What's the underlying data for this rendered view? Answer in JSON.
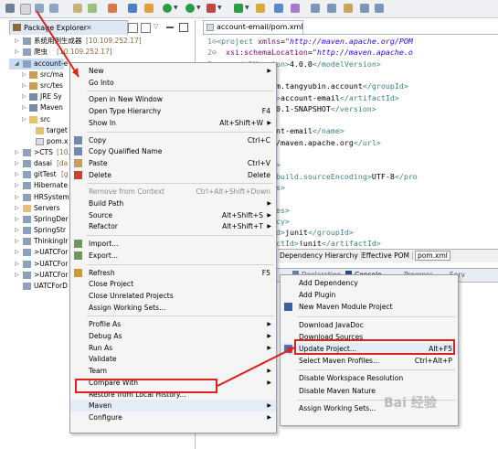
{
  "colors": {
    "accent_red": "#e0201a",
    "menu_bg": "#f5f5f5",
    "selection": "#c9dcf4"
  },
  "package_explorer": {
    "tab_label": "Package Explorer",
    "tree": [
      {
        "label": "系统用例生成器",
        "suffix": "[10.109.252.17]",
        "icon": "project-icon"
      },
      {
        "label": "爬虫",
        "suffix": "[10.109.252.17]",
        "icon": "project-icon"
      },
      {
        "label": "account-e",
        "suffix": "",
        "icon": "maven-project-icon"
      },
      {
        "label": "src/ma",
        "suffix": "",
        "icon": "source-folder-icon"
      },
      {
        "label": "src/tes",
        "suffix": "",
        "icon": "source-folder-icon"
      },
      {
        "label": "JRE Sy",
        "suffix": "",
        "icon": "library-icon"
      },
      {
        "label": "Maven",
        "suffix": "",
        "icon": "library-icon"
      },
      {
        "label": "src",
        "suffix": "",
        "icon": "folder-icon"
      },
      {
        "label": "target",
        "suffix": "",
        "icon": "folder-icon"
      },
      {
        "label": "pom.x",
        "suffix": "",
        "icon": "xml-file-icon"
      },
      {
        "label": ">CTS",
        "suffix": "[10.",
        "icon": "project-icon"
      },
      {
        "label": "dasai",
        "suffix": "[da",
        "icon": "project-icon"
      },
      {
        "label": "gitTest",
        "suffix": "[g",
        "icon": "project-icon"
      },
      {
        "label": "Hibernate",
        "suffix": "",
        "icon": "project-icon"
      },
      {
        "label": "HRSystem",
        "suffix": "",
        "icon": "project-icon"
      },
      {
        "label": "Servers",
        "suffix": "",
        "icon": "folder-icon"
      },
      {
        "label": "SpringDer",
        "suffix": "",
        "icon": "project-icon"
      },
      {
        "label": "SpringStr",
        "suffix": "",
        "icon": "project-icon"
      },
      {
        "label": "ThinkingIr",
        "suffix": "",
        "icon": "project-icon"
      },
      {
        "label": ">UATCFor",
        "suffix": "",
        "icon": "project-icon"
      },
      {
        "label": ">UATCFor",
        "suffix": "",
        "icon": "project-icon"
      },
      {
        "label": ">UATCFor",
        "suffix": "",
        "icon": "project-icon"
      },
      {
        "label": "UATCForD",
        "suffix": "",
        "icon": "project-icon"
      }
    ]
  },
  "editor": {
    "tab_label": "account-email/pom.xml",
    "lines": [
      {
        "n": "1",
        "html": "<span class='tg'>&lt;project</span> <span class='at'>xmlns</span>=<span class='av'>\"http://maven.apache.org/POM</span>"
      },
      {
        "n": "2",
        "html": "  <span class='at'>xsi:schemaLocation</span>=<span class='av'>\"http://maven.apache.o</span>"
      },
      {
        "n": "3",
        "html": "  <span class='tg'>&lt;modelVersion&gt;</span>4.0.0<span class='tg'>&lt;/modelVersion&gt;</span>"
      },
      {
        "n": "",
        "html": ""
      },
      {
        "n": "",
        "html": "  <span class='tg'>&lt;groupId&gt;</span>com.tangyubin.account<span class='tg'>&lt;/groupId&gt;</span>"
      },
      {
        "n": "",
        "html": "  <span class='tg'>&lt;artifactId&gt;</span>account-email<span class='tg'>&lt;/artifactId&gt;</span>"
      },
      {
        "n": "",
        "html": "  <span class='tg'>&lt;version&gt;</span>0.0.1-SNAPSHOT<span class='tg'>&lt;/version&gt;</span>"
      },
      {
        "n": "",
        "html": ""
      },
      {
        "n": "",
        "html": "  <span class='tg'>&lt;name&gt;</span>account-email<span class='tg'>&lt;/name&gt;</span>"
      },
      {
        "n": "",
        "html": "  <span class='tg'>&lt;url&gt;</span>http://maven.apache.org<span class='tg'>&lt;/url&gt;</span>"
      },
      {
        "n": "",
        "html": ""
      },
      {
        "n": "",
        "html": "  <span class='tg'>&lt;properties&gt;</span>"
      },
      {
        "n": "",
        "html": "    <span class='tg'>&lt;project.build.sourceEncoding&gt;</span>UTF-8<span class='tg'>&lt;/pro</span>"
      },
      {
        "n": "",
        "html": "  <span class='tg'>&lt;/properties&gt;</span>"
      },
      {
        "n": "",
        "html": ""
      },
      {
        "n": "",
        "html": "  <span class='tg'>&lt;dependencies&gt;</span>"
      },
      {
        "n": "",
        "html": "    <span class='tg'>&lt;dependency&gt;</span>"
      },
      {
        "n": "",
        "html": "      <span class='tg'>&lt;groupId&gt;</span>junit<span class='tg'>&lt;/groupId&gt;</span>"
      },
      {
        "n": "",
        "html": "      <span class='tg'>&lt;artifactId&gt;</span>junit<span class='tg'>&lt;/artifactId&gt;</span>"
      }
    ],
    "bottom_tabs": [
      "Dependency Hierarchy",
      "Effective POM",
      "pom.xml"
    ]
  },
  "console_tabs": [
    "Declaration",
    "Console",
    "Progress",
    "Serv"
  ],
  "context_menu": {
    "items": [
      {
        "label": "New",
        "key": "",
        "arrow": true
      },
      {
        "label": "Go Into",
        "key": ""
      },
      {
        "sep": true
      },
      {
        "label": "Open in New Window",
        "key": ""
      },
      {
        "label": "Open Type Hierarchy",
        "key": "F4"
      },
      {
        "label": "Show In",
        "key": "Alt+Shift+W",
        "arrow": true
      },
      {
        "sep": true
      },
      {
        "label": "Copy",
        "key": "Ctrl+C",
        "icon": "copy-icon"
      },
      {
        "label": "Copy Qualified Name",
        "key": "",
        "icon": "copy-icon"
      },
      {
        "label": "Paste",
        "key": "Ctrl+V",
        "icon": "paste-icon"
      },
      {
        "label": "Delete",
        "key": "Delete",
        "icon": "delete-icon"
      },
      {
        "sep": true
      },
      {
        "label": "Remove from Context",
        "key": "Ctrl+Alt+Shift+Down",
        "disabled": true
      },
      {
        "label": "Build Path",
        "key": "",
        "arrow": true
      },
      {
        "label": "Source",
        "key": "Alt+Shift+S",
        "arrow": true
      },
      {
        "label": "Refactor",
        "key": "Alt+Shift+T",
        "arrow": true
      },
      {
        "sep": true
      },
      {
        "label": "Import...",
        "key": "",
        "icon": "import-icon"
      },
      {
        "label": "Export...",
        "key": "",
        "icon": "export-icon"
      },
      {
        "sep": true
      },
      {
        "label": "Refresh",
        "key": "F5",
        "icon": "refresh-icon"
      },
      {
        "label": "Close Project",
        "key": ""
      },
      {
        "label": "Close Unrelated Projects",
        "key": ""
      },
      {
        "label": "Assign Working Sets...",
        "key": ""
      },
      {
        "sep": true
      },
      {
        "label": "Profile As",
        "key": "",
        "arrow": true
      },
      {
        "label": "Debug As",
        "key": "",
        "arrow": true
      },
      {
        "label": "Run As",
        "key": "",
        "arrow": true
      },
      {
        "label": "Validate",
        "key": ""
      },
      {
        "label": "Team",
        "key": "",
        "arrow": true
      },
      {
        "label": "Compare With",
        "key": "",
        "arrow": true
      },
      {
        "label": "Restore from Local History...",
        "key": ""
      },
      {
        "label": "Maven",
        "key": "",
        "arrow": true,
        "highlight": true
      },
      {
        "label": "Configure",
        "key": "",
        "arrow": true
      }
    ]
  },
  "maven_submenu": {
    "items": [
      {
        "label": "Add Dependency",
        "key": ""
      },
      {
        "label": "Add Plugin",
        "key": ""
      },
      {
        "label": "New Maven Module Project",
        "key": "",
        "icon": "maven-icon"
      },
      {
        "sep": true
      },
      {
        "label": "Download JavaDoc",
        "key": ""
      },
      {
        "label": "Download Sources",
        "key": ""
      },
      {
        "label": "Update Project...",
        "key": "Alt+F5",
        "icon": "update-icon",
        "highlight": true
      },
      {
        "label": "Select Maven Profiles...",
        "key": "Ctrl+Alt+P"
      },
      {
        "sep": true
      },
      {
        "label": "Disable Workspace Resolution",
        "key": ""
      },
      {
        "label": "Disable Maven Nature",
        "key": ""
      },
      {
        "sep": true
      },
      {
        "label": "Assign Working Sets...",
        "key": ""
      }
    ]
  },
  "watermark": "Bai 经验"
}
